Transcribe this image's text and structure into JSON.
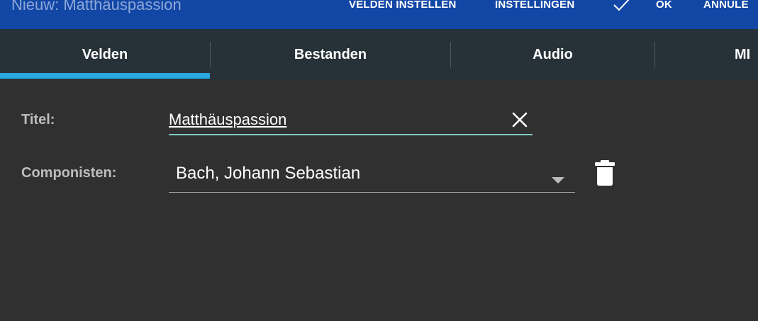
{
  "appbar": {
    "title": "Nieuw: Matthäuspassion",
    "actions": {
      "velden_instellen": "VELDEN INSTELLEN",
      "instellingen": "INSTELLINGEN",
      "ok": "OK",
      "annuleren": "ANNULE"
    },
    "confirm_icon": "check-icon",
    "color": "#1347a6"
  },
  "tabs": {
    "items": [
      {
        "label": "Velden",
        "selected": true
      },
      {
        "label": "Bestanden",
        "selected": false
      },
      {
        "label": "Audio",
        "selected": false
      },
      {
        "label": "MI",
        "selected": false
      }
    ],
    "indicator_color": "#29a8e0",
    "background": "#263238"
  },
  "form": {
    "title": {
      "label": "Titel:",
      "value": "Matthäuspassion",
      "clear_icon": "close-icon",
      "underline_color": "#80cbc4"
    },
    "composers": {
      "label": "Componisten:",
      "value": "Bach, Johann Sebastian",
      "dropdown_icon": "dropdown-arrow-icon",
      "delete_icon": "trash-icon"
    }
  },
  "background": "#303030"
}
